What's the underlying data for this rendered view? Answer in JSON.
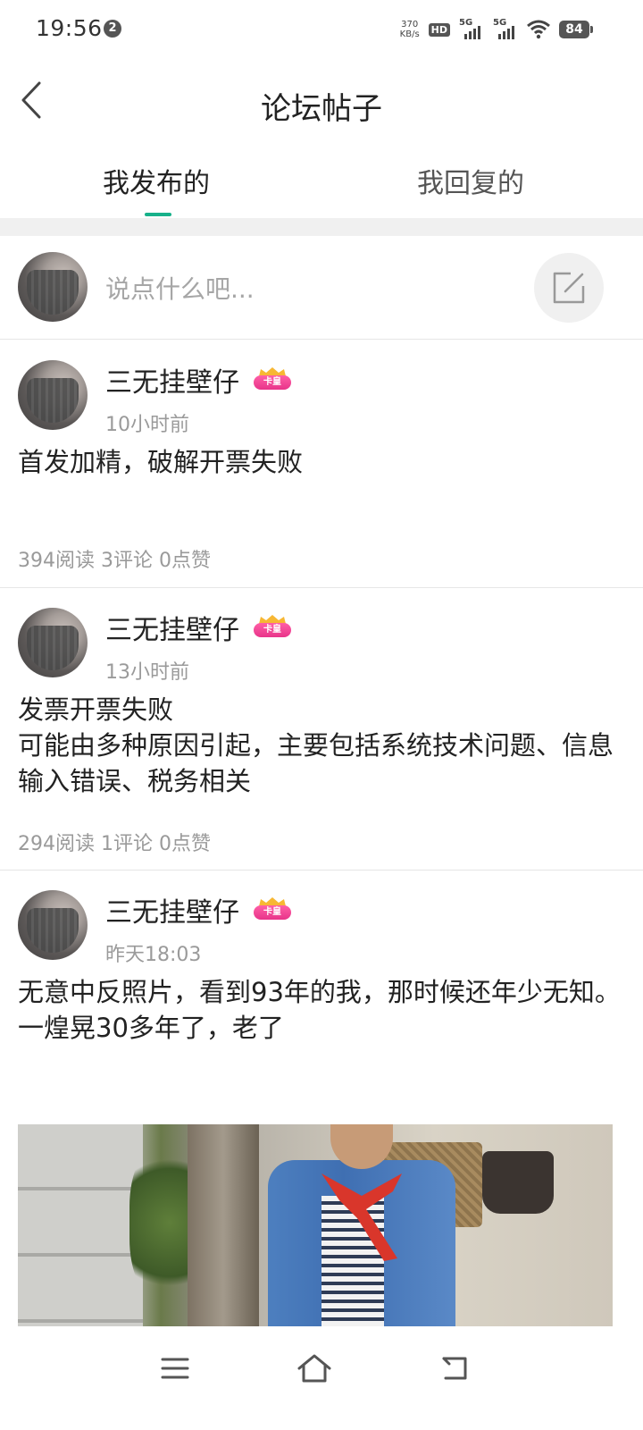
{
  "status_bar": {
    "time": "19:56",
    "notification_count": "2",
    "net_speed_value": "370",
    "net_speed_unit": "KB/s",
    "hd_label": "HD",
    "signal1_label": "5G",
    "signal2_label": "5G",
    "battery": "84"
  },
  "header": {
    "title": "论坛帖子",
    "back_icon": "chevron-left-icon"
  },
  "tabs": [
    {
      "label": "我发布的",
      "active": true
    },
    {
      "label": "我回复的",
      "active": false
    }
  ],
  "composer": {
    "placeholder": "说点什么吧...",
    "button_icon": "edit-icon"
  },
  "posts": [
    {
      "author": "三无挂壁仔",
      "badge": "卡皇",
      "time": "10小时前",
      "body": "首发加精，破解开票失败",
      "stats": "394阅读 3评论 0点赞"
    },
    {
      "author": "三无挂壁仔",
      "badge": "卡皇",
      "time": "13小时前",
      "body": "发票开票失败\n可能由多种原因引起，主要包括系统技术问题、信息输入错误、税务相关",
      "stats": "294阅读 1评论 0点赞"
    },
    {
      "author": "三无挂壁仔",
      "badge": "卡皇",
      "time": "昨天18:03",
      "body": "无意中反照片，看到93年的我，那时候还年少无知。一煌晃30多年了，老了",
      "has_photo": true
    }
  ],
  "colors": {
    "accent": "#17b18a",
    "badge_pink": "#e8348a",
    "muted_text": "#9a9a9a"
  },
  "nav_bar": {
    "menu_icon": "menu-icon",
    "home_icon": "home-icon",
    "back_icon": "back-icon"
  }
}
